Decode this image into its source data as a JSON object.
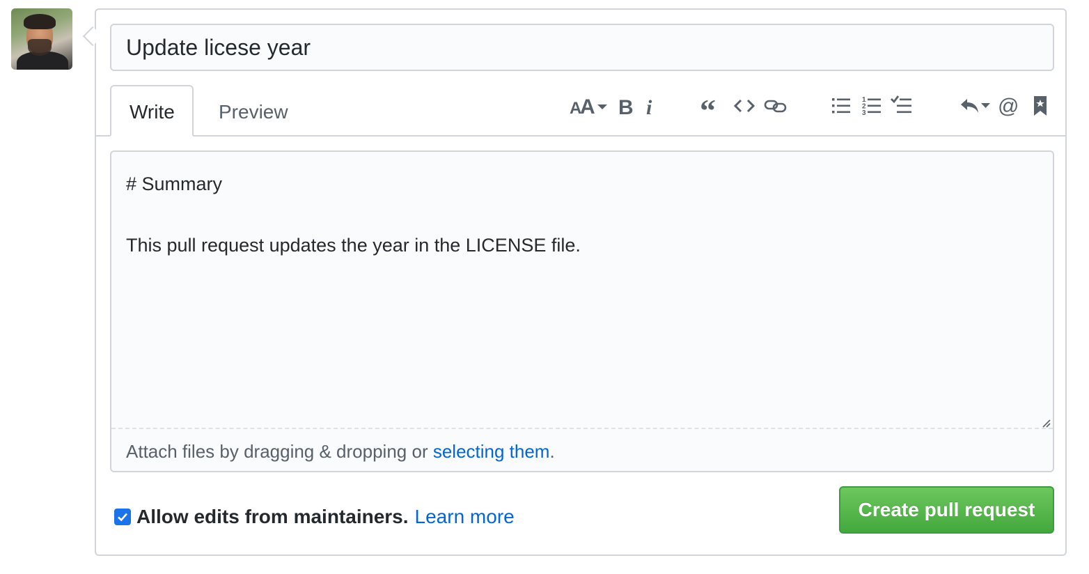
{
  "pr_form": {
    "title_value": "Update licese year",
    "tabs": [
      {
        "label": "Write",
        "active": true
      },
      {
        "label": "Preview",
        "active": false
      }
    ],
    "toolbar_icons": [
      "text-size-icon",
      "bold-icon",
      "italic-icon",
      "quote-icon",
      "code-icon",
      "link-icon",
      "bulleted-list-icon",
      "numbered-list-icon",
      "task-list-icon",
      "reply-icon",
      "mention-icon",
      "bookmark-icon"
    ],
    "body_lines": [
      "# Summary",
      "",
      "This pull request updates the year in the LICENSE file."
    ],
    "attach": {
      "prefix": "Attach files by dragging & dropping or ",
      "link": "selecting them",
      "suffix": "."
    },
    "allow_edits": {
      "checked": true,
      "label": "Allow edits from maintainers.",
      "learn_more": "Learn more"
    },
    "submit_label": "Create pull request"
  },
  "colors": {
    "accent_link": "#0366d6",
    "checkbox": "#1a73e8",
    "button_green": "#43a83d",
    "border": "#d1d5da"
  }
}
